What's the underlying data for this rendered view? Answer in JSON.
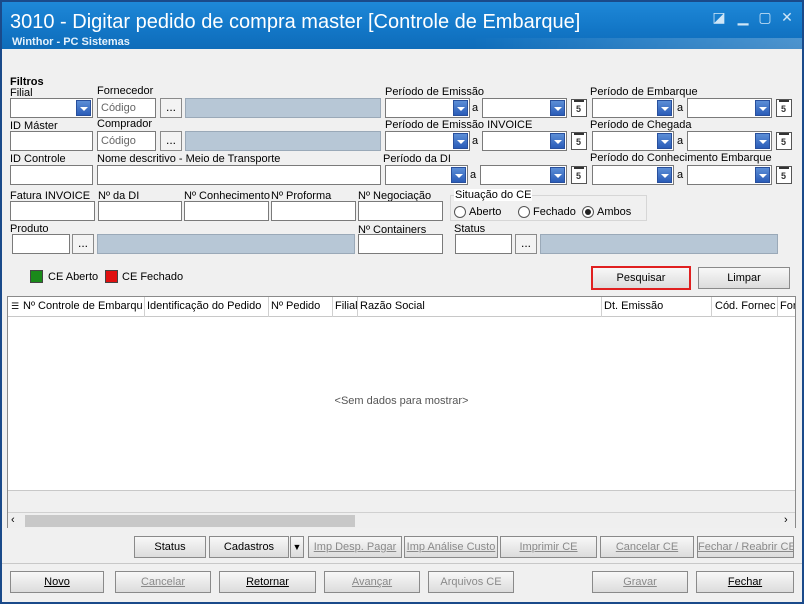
{
  "window": {
    "title": "3010 - Digitar pedido de compra master [Controle de Embarque]",
    "subtitle": "Winthor - PC Sistemas",
    "controls": [
      "restore-icon",
      "minimize-icon",
      "maximize-icon",
      "close-icon"
    ]
  },
  "filters": {
    "heading": "Filtros",
    "filial": "Filial",
    "fornecedor": "Fornecedor",
    "fornecedor_placeholder": "Código",
    "periodo_emissao": "Período de Emissão",
    "periodo_embarque": "Período de Embarque",
    "id_master": "ID Máster",
    "comprador": "Comprador",
    "comprador_placeholder": "Código",
    "periodo_emissao_invoice": "Período de Emissão INVOICE",
    "periodo_chegada": "Período de Chegada",
    "id_controle": "ID Controle",
    "nome_descritivo": "Nome descritivo - Meio de Transporte",
    "periodo_di": "Período da DI",
    "periodo_conhecimento": "Período do Conhecimento Embarque",
    "fatura_invoice": "Fatura INVOICE",
    "n_di": "Nº da DI",
    "n_conhecimento": "Nº Conhecimento",
    "n_proforma": "Nº Proforma",
    "n_negociacao": "Nº Negociação",
    "situacao_ce": "Situação do CE",
    "situacao_options": [
      "Aberto",
      "Fechado",
      "Ambos"
    ],
    "produto": "Produto",
    "n_containers": "Nº Containers",
    "status": "Status",
    "range_sep": "a",
    "ellipsis": "..."
  },
  "legend": {
    "aberto": "CE Aberto",
    "fechado": "CE Fechado",
    "aberto_color": "#1a8a1a",
    "fechado_color": "#e01010"
  },
  "actions": {
    "pesquisar": "Pesquisar",
    "limpar": "Limpar",
    "pesquisar_highlight": "#e02020"
  },
  "grid": {
    "columns": [
      "Nº Controle de Embarque",
      "Identificação do Pedido",
      "Nº Pedido",
      "Filial",
      "Razão Social",
      "Dt. Emissão",
      "Cód. Fornec",
      "For"
    ],
    "empty_text": "<Sem dados para mostrar>"
  },
  "toolbar1": [
    "Status",
    "Cadastros",
    "Imp Desp. Pagar",
    "Imp Análise Custo",
    "Imprimir CE",
    "Cancelar CE",
    "Fechar / Reabrir CE"
  ],
  "toolbar2": [
    "Novo",
    "Cancelar",
    "Retornar",
    "Avançar",
    "Arquivos CE",
    "Gravar",
    "Fechar"
  ]
}
